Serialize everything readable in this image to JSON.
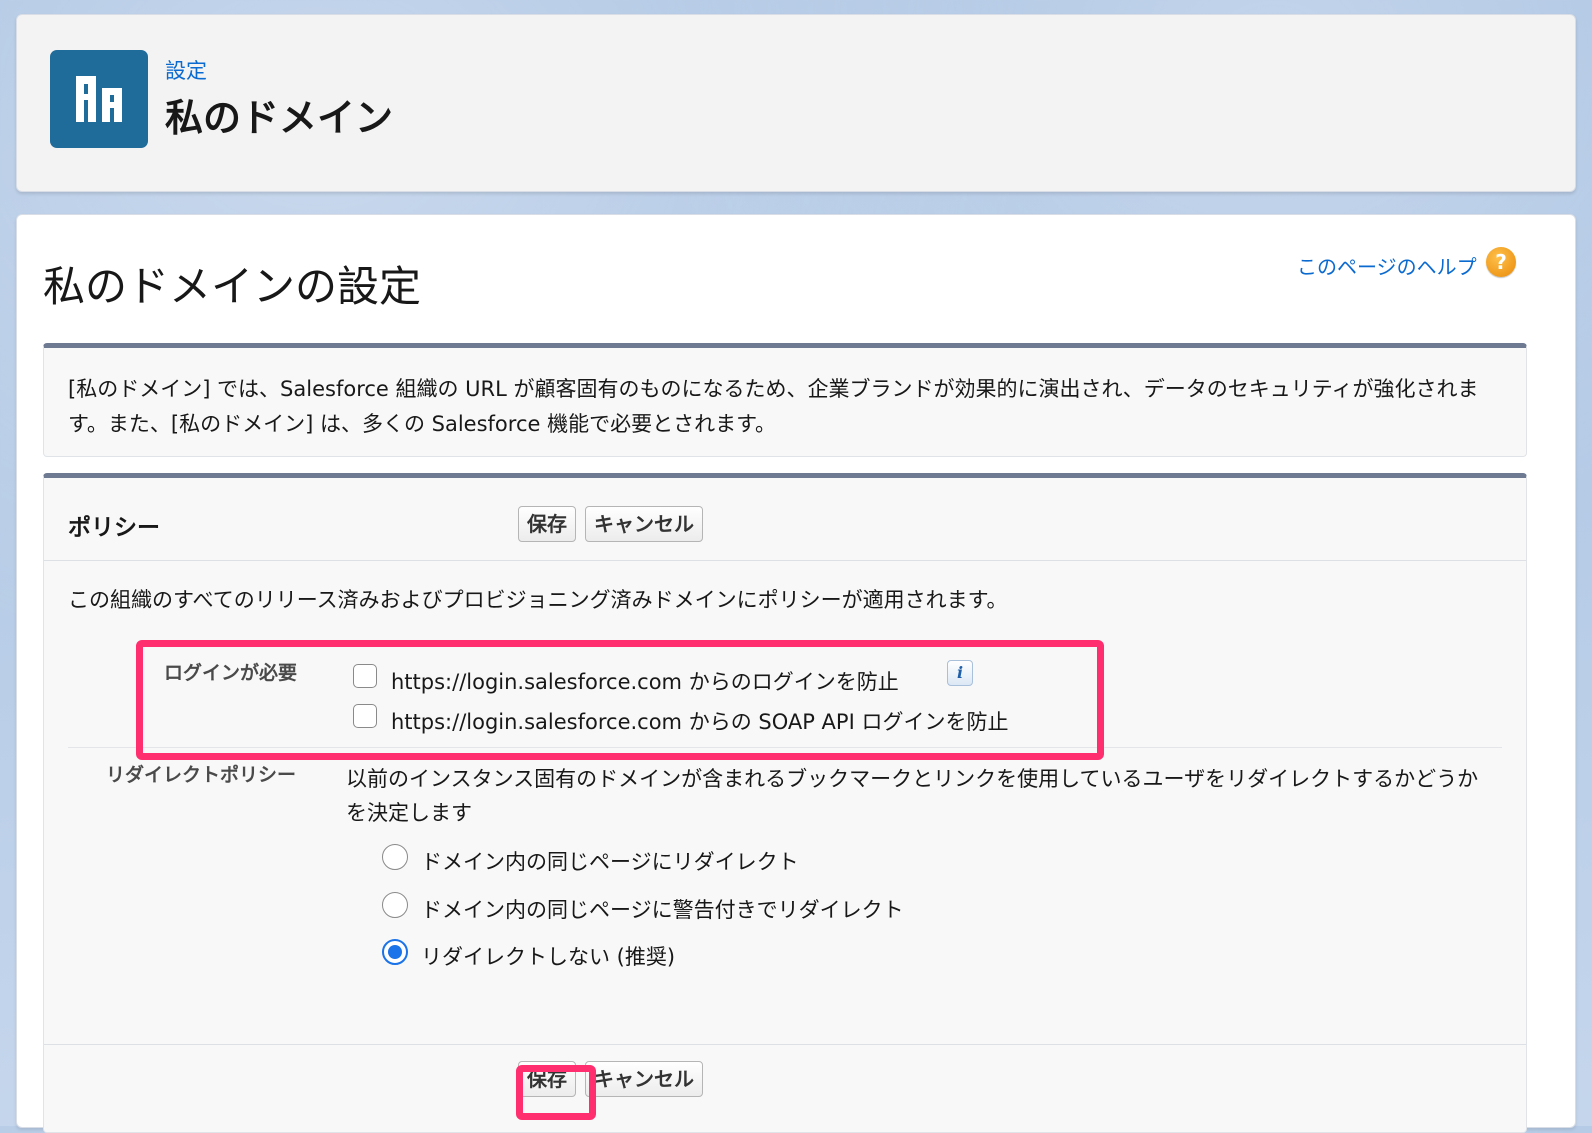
{
  "header": {
    "breadcrumb": "設定",
    "title": "私のドメイン",
    "icon": "building-icon"
  },
  "main": {
    "title": "私のドメインの設定",
    "help_link": "このページのヘルプ",
    "help_icon": "?",
    "intro_text": "[私のドメイン] では、Salesforce 組織の URL が顧客固有のものになるため、企業ブランドが効果的に演出され、データのセキュリティが強化されます。また、[私のドメイン] は、多くの Salesforce 機能で必要とされます。"
  },
  "policy": {
    "title": "ポリシー",
    "save_label": "保存",
    "cancel_label": "キャンセル",
    "description": "この組織のすべてのリリース済みおよびプロビジョニング済みドメインにポリシーが適用されます。",
    "login_required": {
      "label": "ログインが必要",
      "options": [
        {
          "text": "https://login.salesforce.com からのログインを防止",
          "checked": false
        },
        {
          "text": "https://login.salesforce.com からの SOAP API ログインを防止",
          "checked": false
        }
      ],
      "info_icon": "i"
    },
    "redirect_policy": {
      "label": "リダイレクトポリシー",
      "description": "以前のインスタンス固有のドメインが含まれるブックマークとリンクを使用しているユーザをリダイレクトするかどうかを決定します",
      "options": [
        {
          "text": "ドメイン内の同じページにリダイレクト",
          "selected": false
        },
        {
          "text": "ドメイン内の同じページに警告付きでリダイレクト",
          "selected": false
        },
        {
          "text": "リダイレクトしない (推奨)",
          "selected": true
        }
      ]
    }
  },
  "colors": {
    "highlight": "#ff2f6f",
    "link": "#0b6ad0",
    "header_icon_bg": "#1f6b9a",
    "radio_selected": "#1a73e8"
  }
}
